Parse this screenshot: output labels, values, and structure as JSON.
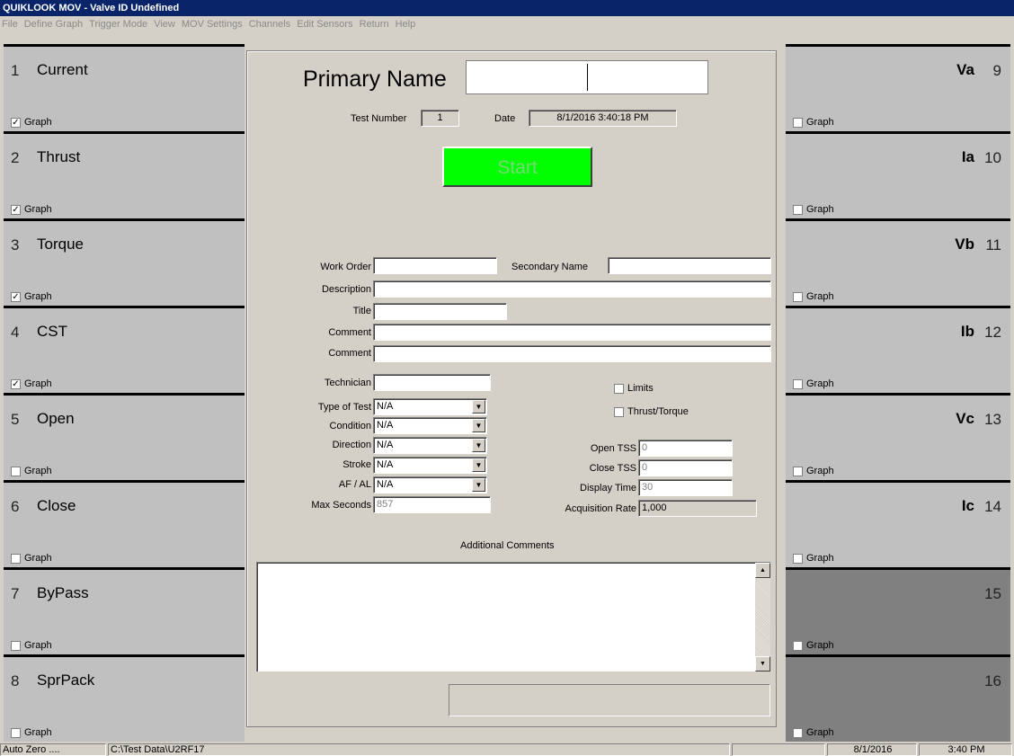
{
  "window": {
    "title": "QUIKLOOK MOV - Valve ID Undefined"
  },
  "menu": [
    "File",
    "Define Graph",
    "Trigger Mode",
    "View",
    "MOV Settings",
    "Channels",
    "Edit Sensors",
    "Return",
    "Help"
  ],
  "channels_left": [
    {
      "num": "1",
      "name": "Current",
      "graph_label": "Graph",
      "checked": true
    },
    {
      "num": "2",
      "name": "Thrust",
      "graph_label": "Graph",
      "checked": true
    },
    {
      "num": "3",
      "name": "Torque",
      "graph_label": "Graph",
      "checked": true
    },
    {
      "num": "4",
      "name": "CST",
      "graph_label": "Graph",
      "checked": true
    },
    {
      "num": "5",
      "name": "Open",
      "graph_label": "Graph",
      "checked": false
    },
    {
      "num": "6",
      "name": "Close",
      "graph_label": "Graph",
      "checked": false
    },
    {
      "num": "7",
      "name": "ByPass",
      "graph_label": "Graph",
      "checked": false
    },
    {
      "num": "8",
      "name": "SprPack",
      "graph_label": "Graph",
      "checked": false
    }
  ],
  "channels_right": [
    {
      "num": "9",
      "name": "Va",
      "graph_label": "Graph",
      "checked": false,
      "dark": false
    },
    {
      "num": "10",
      "name": "Ia",
      "graph_label": "Graph",
      "checked": false,
      "dark": false
    },
    {
      "num": "11",
      "name": "Vb",
      "graph_label": "Graph",
      "checked": false,
      "dark": false
    },
    {
      "num": "12",
      "name": "Ib",
      "graph_label": "Graph",
      "checked": false,
      "dark": false
    },
    {
      "num": "13",
      "name": "Vc",
      "graph_label": "Graph",
      "checked": false,
      "dark": false
    },
    {
      "num": "14",
      "name": "Ic",
      "graph_label": "Graph",
      "checked": false,
      "dark": false
    },
    {
      "num": "15",
      "name": "",
      "graph_label": "Graph",
      "checked": false,
      "dark": true
    },
    {
      "num": "16",
      "name": "",
      "graph_label": "Graph",
      "checked": false,
      "dark": true
    }
  ],
  "form": {
    "primary_name_label": "Primary Name",
    "primary_name_value": "",
    "test_number_label": "Test Number",
    "test_number_value": "1",
    "date_label": "Date",
    "date_value": "8/1/2016 3:40:18 PM",
    "start_label": "Start",
    "work_order_label": "Work Order",
    "work_order_value": "",
    "secondary_name_label": "Secondary Name",
    "secondary_name_value": "",
    "description_label": "Description",
    "description_value": "",
    "title_label": "Title",
    "title_value": "",
    "comment1_label": "Comment",
    "comment1_value": "",
    "comment2_label": "Comment",
    "comment2_value": "",
    "technician_label": "Technician",
    "technician_value": "",
    "type_of_test_label": "Type of Test",
    "type_of_test_value": "N/A",
    "condition_label": "Condition",
    "condition_value": "N/A",
    "direction_label": "Direction",
    "direction_value": "N/A",
    "stroke_label": "Stroke",
    "stroke_value": "N/A",
    "afal_label": "AF / AL",
    "afal_value": "N/A",
    "max_seconds_label": "Max Seconds",
    "max_seconds_value": "857",
    "limits_label": "Limits",
    "thrust_torque_label": "Thrust/Torque",
    "open_tss_label": "Open TSS",
    "open_tss_value": "0",
    "close_tss_label": "Close TSS",
    "close_tss_value": "0",
    "display_time_label": "Display Time",
    "display_time_value": "30",
    "acq_rate_label": "Acquisition Rate",
    "acq_rate_value": "1,000",
    "additional_comments_label": "Additional Comments"
  },
  "status": {
    "left": "Auto Zero ....",
    "path": "C:\\Test Data\\U2RF17",
    "date": "8/1/2016",
    "time": "3:40 PM"
  },
  "icons": {
    "dropdown": "chevron-down-icon",
    "scroll_up": "scroll-up-icon",
    "scroll_down": "scroll-down-icon",
    "checkmark": "checkmark-icon"
  },
  "colors": {
    "titlebar": "#0a246a",
    "start_button": "#00ff00",
    "channel_bg": "#c0c0c0",
    "channel_dark_bg": "#808080"
  }
}
